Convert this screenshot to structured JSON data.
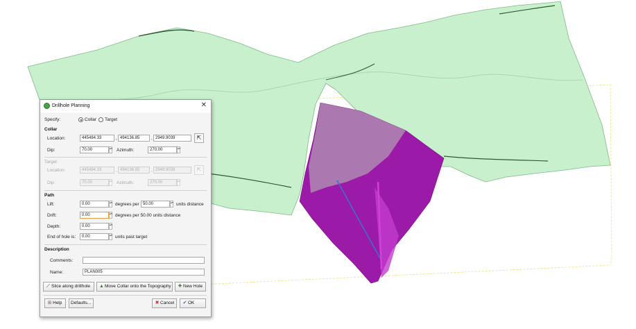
{
  "window": {
    "title": "Drillhole Planning"
  },
  "specify": {
    "label": "Specify:",
    "options": [
      "Collar",
      "Target"
    ],
    "selected": "Collar"
  },
  "collar": {
    "header": "Collar",
    "location_label": "Location:",
    "x": "445484.33",
    "y": "494136.85",
    "z": "2949.9039",
    "dip_label": "Dip:",
    "dip": "70.00",
    "azimuth_label": "Azimuth:",
    "azimuth": "270.00"
  },
  "target": {
    "header": "Target",
    "location_label": "Location:",
    "x": "445484.33",
    "y": "494136.85",
    "z": "2949.9039",
    "dip_label": "Dip:",
    "dip": "70.00",
    "azimuth_label": "Azimuth:",
    "azimuth": "270.00"
  },
  "path": {
    "header": "Path",
    "lift_label": "Lift:",
    "lift": "0.00",
    "lift_per_text": "degrees per",
    "lift_dist": "50.00",
    "lift_unit_text": "units distance",
    "drift_label": "Drift:",
    "drift": "0.00",
    "drift_text": "degrees per 50.00 units distance",
    "depth_label": "Depth:",
    "depth": "0.00",
    "end_label": "End of hole is:",
    "end": "0.00",
    "end_text": "units past target"
  },
  "description": {
    "header": "Description",
    "comments_label": "Comments:",
    "comments": "",
    "name_label": "Name:",
    "name": "PLAN005"
  },
  "actions": {
    "slice": "Slice along drillhole",
    "move": "Move Collar onto the Topography",
    "new": "New Hole"
  },
  "footer": {
    "help": "Help",
    "defaults": "Defaults...",
    "cancel": "Cancel",
    "ok": "OK"
  },
  "scene": {
    "topo_fill": "#c8f0cc",
    "topo_stroke": "#7fb886",
    "shell_color": "#9c1aa8",
    "drill_color": "#3a6fd0"
  }
}
